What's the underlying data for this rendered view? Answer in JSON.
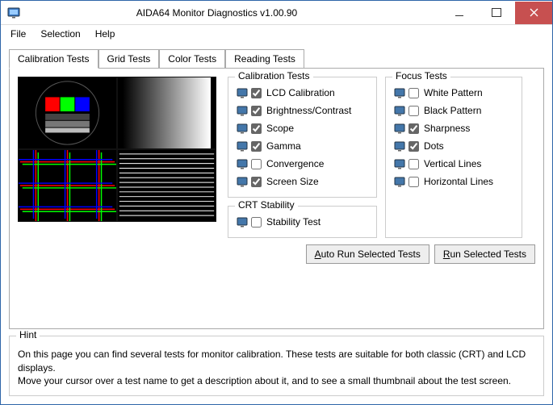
{
  "window": {
    "title": "AIDA64 Monitor Diagnostics v1.00.90"
  },
  "menu": {
    "file": "File",
    "selection": "Selection",
    "help": "Help"
  },
  "tabs": {
    "calibration": "Calibration Tests",
    "grid": "Grid Tests",
    "color": "Color Tests",
    "reading": "Reading Tests"
  },
  "groups": {
    "calibration_tests": "Calibration Tests",
    "focus_tests": "Focus Tests",
    "crt_stability": "CRT Stability"
  },
  "tests": {
    "lcd_calibration": {
      "label": "LCD Calibration",
      "checked": true
    },
    "brightness_contrast": {
      "label": "Brightness/Contrast",
      "checked": true
    },
    "scope": {
      "label": "Scope",
      "checked": true
    },
    "gamma": {
      "label": "Gamma",
      "checked": true
    },
    "convergence": {
      "label": "Convergence",
      "checked": false
    },
    "screen_size": {
      "label": "Screen Size",
      "checked": true
    },
    "white_pattern": {
      "label": "White Pattern",
      "checked": false
    },
    "black_pattern": {
      "label": "Black Pattern",
      "checked": false
    },
    "sharpness": {
      "label": "Sharpness",
      "checked": true
    },
    "dots": {
      "label": "Dots",
      "checked": true
    },
    "vertical_lines": {
      "label": "Vertical Lines",
      "checked": false
    },
    "horizontal_lines": {
      "label": "Horizontal Lines",
      "checked": false
    },
    "stability_test": {
      "label": "Stability Test",
      "checked": false
    }
  },
  "buttons": {
    "auto_run": "Auto Run Selected Tests",
    "run": "Run Selected Tests"
  },
  "hint": {
    "heading": "Hint",
    "line1": "On this page you can find several tests for monitor calibration. These tests are suitable for both classic (CRT) and LCD displays.",
    "line2": "Move your cursor over a test name to get a description about it, and to see a small thumbnail about the test screen."
  }
}
